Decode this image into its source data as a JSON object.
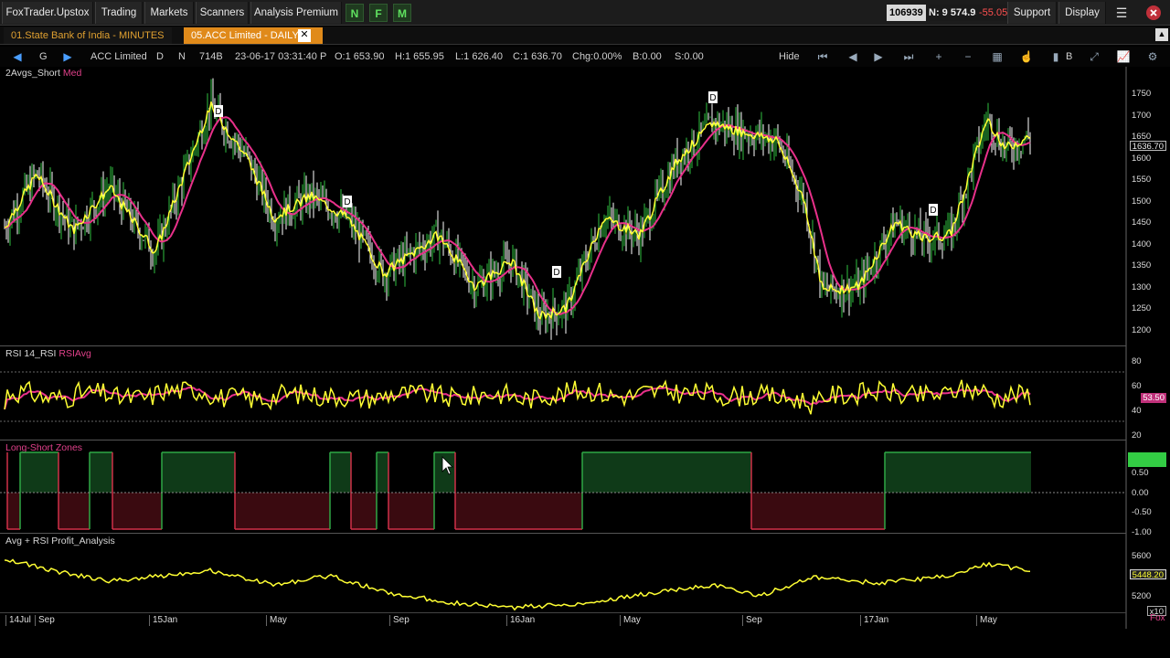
{
  "topbar": {
    "brand": "FoxTrader.Upstox",
    "menus": [
      "Trading",
      "Markets",
      "Scanners",
      "Analysis Premium"
    ],
    "letters": [
      "N",
      "F",
      "M"
    ],
    "ticker_id": "106939",
    "ticker_value": "N: 9 574.95",
    "ticker_change": "-55.05",
    "support": "Support",
    "display": "Display"
  },
  "tabs": [
    {
      "label": "01.State Bank of India - MINUTES",
      "active": false
    },
    {
      "label": "05.ACC Limited - DAILY",
      "active": true
    }
  ],
  "charttb": {
    "symbol": "ACC Limited",
    "g": "G",
    "d": "D",
    "n": "N",
    "code": "714B",
    "datetime": "23-06-17 03:31:40 P",
    "open": "O:1 653.90",
    "high": "H:1 655.95",
    "low": "L:1 626.40",
    "close": "C:1 636.70",
    "change": "Chg:0.00%",
    "b": "B:0.00",
    "s": "S:0.00",
    "hide": "Hide",
    "bee": "B"
  },
  "panels": {
    "price": {
      "title": "2Avgs_Short",
      "sub": "Med",
      "last": "1636.70",
      "ticks": [
        "1750",
        "1700",
        "1650",
        "1600",
        "1550",
        "1500",
        "1450",
        "1400",
        "1350",
        "1300",
        "1250",
        "1200"
      ]
    },
    "rsi": {
      "title": "RSI 14_RSI",
      "sub": "RSIAvg",
      "last": "53.50",
      "ticks": [
        "80",
        "60",
        "40",
        "20"
      ]
    },
    "zones": {
      "title": "Long-Short Zones",
      "ticks": [
        "0.50",
        "0.00",
        "-0.50",
        "-1.00"
      ]
    },
    "profit": {
      "title": "Avg + RSI Profit_Analysis",
      "last": "5448.20",
      "ticks": [
        "5600",
        "5200"
      ],
      "scale": "x10"
    }
  },
  "time_axis": [
    "14Jul",
    "Sep",
    "15Jan",
    "May",
    "Sep",
    "16Jan",
    "May",
    "Sep",
    "17Jan",
    "May"
  ],
  "footer_text": "Fox",
  "colors": {
    "price_line": "#ffff33",
    "avg_line": "#e8308a",
    "long": "#0f3a18",
    "short": "#3a0a10",
    "zone_line_green": "#2fa845",
    "zone_line_red": "#d03048"
  },
  "chart_data": {
    "type": "line",
    "title": "",
    "x": [
      "14Jul",
      "Sep",
      "15Jan",
      "May",
      "Sep",
      "16Jan",
      "May",
      "Sep",
      "17Jan",
      "May"
    ],
    "series": [
      {
        "name": "2Avgs_Short",
        "values": [
          1450,
          1560,
          1700,
          1490,
          1420,
          1240,
          1580,
          1700,
          1300,
          1500,
          1660
        ]
      },
      {
        "name": "Med",
        "values": [
          1440,
          1520,
          1650,
          1500,
          1440,
          1280,
          1540,
          1660,
          1330,
          1480,
          1620
        ]
      }
    ],
    "ylim": [
      1180,
      1770
    ],
    "markers": [
      "D",
      "D",
      "D",
      "D",
      "D"
    ]
  }
}
